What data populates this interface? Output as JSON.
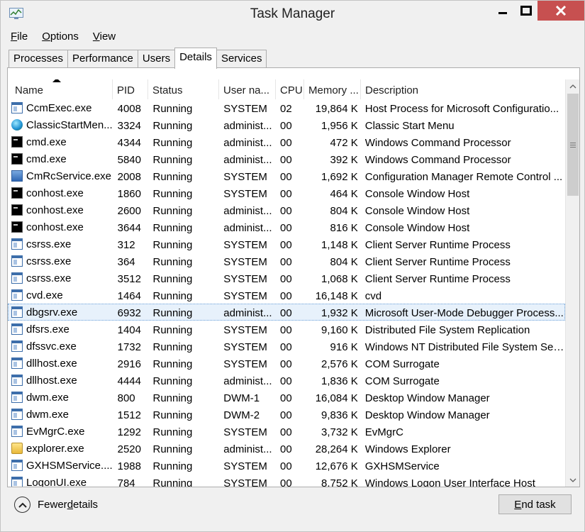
{
  "window": {
    "title": "Task Manager"
  },
  "menu": {
    "file": {
      "accel": "F",
      "rest": "ile"
    },
    "options": {
      "accel": "O",
      "rest": "ptions"
    },
    "view": {
      "accel": "V",
      "rest": "iew"
    }
  },
  "tabs": [
    "Processes",
    "Performance",
    "Users",
    "Details",
    "Services"
  ],
  "active_tab": "Details",
  "columns": {
    "name": "Name",
    "pid": "PID",
    "status": "Status",
    "user": "User na...",
    "cpu": "CPU",
    "memory": "Memory ...",
    "description": "Description"
  },
  "sort": {
    "column": "Name",
    "direction": "ascending"
  },
  "rows": [
    {
      "icon": "window-icon",
      "name": "CcmExec.exe",
      "pid": "4008",
      "status": "Running",
      "user": "SYSTEM",
      "cpu": "02",
      "memory": "19,864 K",
      "description": "Host Process for Microsoft Configuratio..."
    },
    {
      "icon": "globe-icon",
      "name": "ClassicStartMen...",
      "pid": "3324",
      "status": "Running",
      "user": "administ...",
      "cpu": "00",
      "memory": "1,956 K",
      "description": "Classic Start Menu"
    },
    {
      "icon": "console-icon",
      "name": "cmd.exe",
      "pid": "4344",
      "status": "Running",
      "user": "administ...",
      "cpu": "00",
      "memory": "472 K",
      "description": "Windows Command Processor"
    },
    {
      "icon": "console-icon",
      "name": "cmd.exe",
      "pid": "5840",
      "status": "Running",
      "user": "administ...",
      "cpu": "00",
      "memory": "392 K",
      "description": "Windows Command Processor"
    },
    {
      "icon": "remote-control-icon",
      "name": "CmRcService.exe",
      "pid": "2008",
      "status": "Running",
      "user": "SYSTEM",
      "cpu": "00",
      "memory": "1,692 K",
      "description": "Configuration Manager Remote Control ..."
    },
    {
      "icon": "console-icon",
      "name": "conhost.exe",
      "pid": "1860",
      "status": "Running",
      "user": "SYSTEM",
      "cpu": "00",
      "memory": "464 K",
      "description": "Console Window Host"
    },
    {
      "icon": "console-icon",
      "name": "conhost.exe",
      "pid": "2600",
      "status": "Running",
      "user": "administ...",
      "cpu": "00",
      "memory": "804 K",
      "description": "Console Window Host"
    },
    {
      "icon": "console-icon",
      "name": "conhost.exe",
      "pid": "3644",
      "status": "Running",
      "user": "administ...",
      "cpu": "00",
      "memory": "816 K",
      "description": "Console Window Host"
    },
    {
      "icon": "window-icon",
      "name": "csrss.exe",
      "pid": "312",
      "status": "Running",
      "user": "SYSTEM",
      "cpu": "00",
      "memory": "1,148 K",
      "description": "Client Server Runtime Process"
    },
    {
      "icon": "window-icon",
      "name": "csrss.exe",
      "pid": "364",
      "status": "Running",
      "user": "SYSTEM",
      "cpu": "00",
      "memory": "804 K",
      "description": "Client Server Runtime Process"
    },
    {
      "icon": "window-icon",
      "name": "csrss.exe",
      "pid": "3512",
      "status": "Running",
      "user": "SYSTEM",
      "cpu": "00",
      "memory": "1,068 K",
      "description": "Client Server Runtime Process"
    },
    {
      "icon": "window-icon",
      "name": "cvd.exe",
      "pid": "1464",
      "status": "Running",
      "user": "SYSTEM",
      "cpu": "00",
      "memory": "16,148 K",
      "description": "cvd"
    },
    {
      "icon": "window-icon",
      "name": "dbgsrv.exe",
      "pid": "6932",
      "status": "Running",
      "user": "administ...",
      "cpu": "00",
      "memory": "1,932 K",
      "description": "Microsoft User-Mode Debugger Process...",
      "selected": true
    },
    {
      "icon": "window-icon",
      "name": "dfsrs.exe",
      "pid": "1404",
      "status": "Running",
      "user": "SYSTEM",
      "cpu": "00",
      "memory": "9,160 K",
      "description": "Distributed File System Replication"
    },
    {
      "icon": "window-icon",
      "name": "dfssvc.exe",
      "pid": "1732",
      "status": "Running",
      "user": "SYSTEM",
      "cpu": "00",
      "memory": "916 K",
      "description": "Windows NT Distributed File System Ser..."
    },
    {
      "icon": "window-icon",
      "name": "dllhost.exe",
      "pid": "2916",
      "status": "Running",
      "user": "SYSTEM",
      "cpu": "00",
      "memory": "2,576 K",
      "description": "COM Surrogate"
    },
    {
      "icon": "window-icon",
      "name": "dllhost.exe",
      "pid": "4444",
      "status": "Running",
      "user": "administ...",
      "cpu": "00",
      "memory": "1,836 K",
      "description": "COM Surrogate"
    },
    {
      "icon": "window-icon",
      "name": "dwm.exe",
      "pid": "800",
      "status": "Running",
      "user": "DWM-1",
      "cpu": "00",
      "memory": "16,084 K",
      "description": "Desktop Window Manager"
    },
    {
      "icon": "window-icon",
      "name": "dwm.exe",
      "pid": "1512",
      "status": "Running",
      "user": "DWM-2",
      "cpu": "00",
      "memory": "9,836 K",
      "description": "Desktop Window Manager"
    },
    {
      "icon": "window-icon",
      "name": "EvMgrC.exe",
      "pid": "1292",
      "status": "Running",
      "user": "SYSTEM",
      "cpu": "00",
      "memory": "3,732 K",
      "description": "EvMgrC"
    },
    {
      "icon": "folder-icon",
      "name": "explorer.exe",
      "pid": "2520",
      "status": "Running",
      "user": "administ...",
      "cpu": "00",
      "memory": "28,264 K",
      "description": "Windows Explorer"
    },
    {
      "icon": "window-icon",
      "name": "GXHSMService....",
      "pid": "1988",
      "status": "Running",
      "user": "SYSTEM",
      "cpu": "00",
      "memory": "12,676 K",
      "description": "GXHSMService"
    },
    {
      "icon": "window-icon",
      "name": "LogonUI.exe",
      "pid": "784",
      "status": "Running",
      "user": "SYSTEM",
      "cpu": "00",
      "memory": "8,752 K",
      "description": "Windows Logon User Interface Host"
    }
  ],
  "footer": {
    "fewer_details": {
      "before": "Fewer ",
      "accel": "d",
      "after": "etails"
    },
    "end_task": {
      "accel": "E",
      "rest": "nd task"
    }
  },
  "colors": {
    "close_button": "#c75050",
    "selection_bg": "#e7f1fb",
    "selection_border": "#6aa0d8"
  }
}
